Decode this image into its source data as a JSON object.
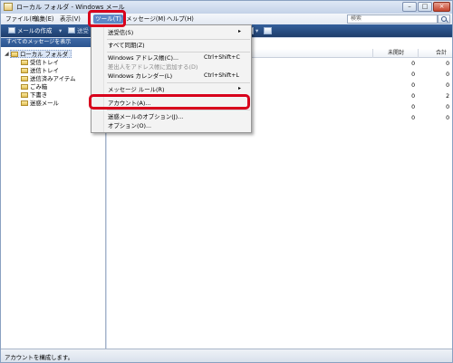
{
  "window": {
    "title": "ローカル フォルダ - Windows メール"
  },
  "menubar": {
    "items": [
      "ファイル(F)",
      "編集(E)",
      "表示(V)",
      "ツール(T)",
      "メッセージ(M)",
      "ヘルプ(H)"
    ],
    "active_index": 3,
    "search_placeholder": "検索"
  },
  "toolbar": {
    "compose_label": "メールの作成",
    "send_receive_label": "送受"
  },
  "folder_pane": {
    "header": "すべてのメッセージを表示",
    "root": "ローカル フォルダ",
    "folders": [
      "受信トレイ",
      "送信トレイ",
      "送信済みアイテム",
      "ごみ箱",
      "下書き",
      "迷惑メール"
    ]
  },
  "message_list": {
    "columns": [
      "未開封",
      "合計"
    ],
    "rows": [
      {
        "unread": "0",
        "total": "0"
      },
      {
        "unread": "0",
        "total": "0"
      },
      {
        "unread": "0",
        "total": "0"
      },
      {
        "unread": "0",
        "total": "2"
      },
      {
        "unread": "0",
        "total": "0"
      },
      {
        "unread": "0",
        "total": "0"
      }
    ]
  },
  "tools_menu": {
    "items": [
      {
        "label": "送受信(S)",
        "submenu": true
      },
      {
        "label": "すべて同期(Z)"
      },
      {
        "label": "Windows アドレス帳(C)...",
        "shortcut": "Ctrl+Shift+C"
      },
      {
        "label": "差出人をアドレス帳に追加する(D)",
        "disabled": true
      },
      {
        "label": "Windows カレンダー(L)",
        "shortcut": "Ctrl+Shift+L"
      },
      {
        "label": "メッセージ ルール(R)",
        "submenu": true
      },
      {
        "label": "アカウント(A)..."
      },
      {
        "label": "迷惑メールのオプション(J)..."
      },
      {
        "label": "オプション(O)..."
      }
    ],
    "submenu_arrow": "▸"
  },
  "statusbar": {
    "text": "アカウントを構成します。"
  },
  "colors": {
    "highlight": "#d8001c",
    "toolbar": "#2b548f",
    "active_menu": "#5d87c6"
  }
}
